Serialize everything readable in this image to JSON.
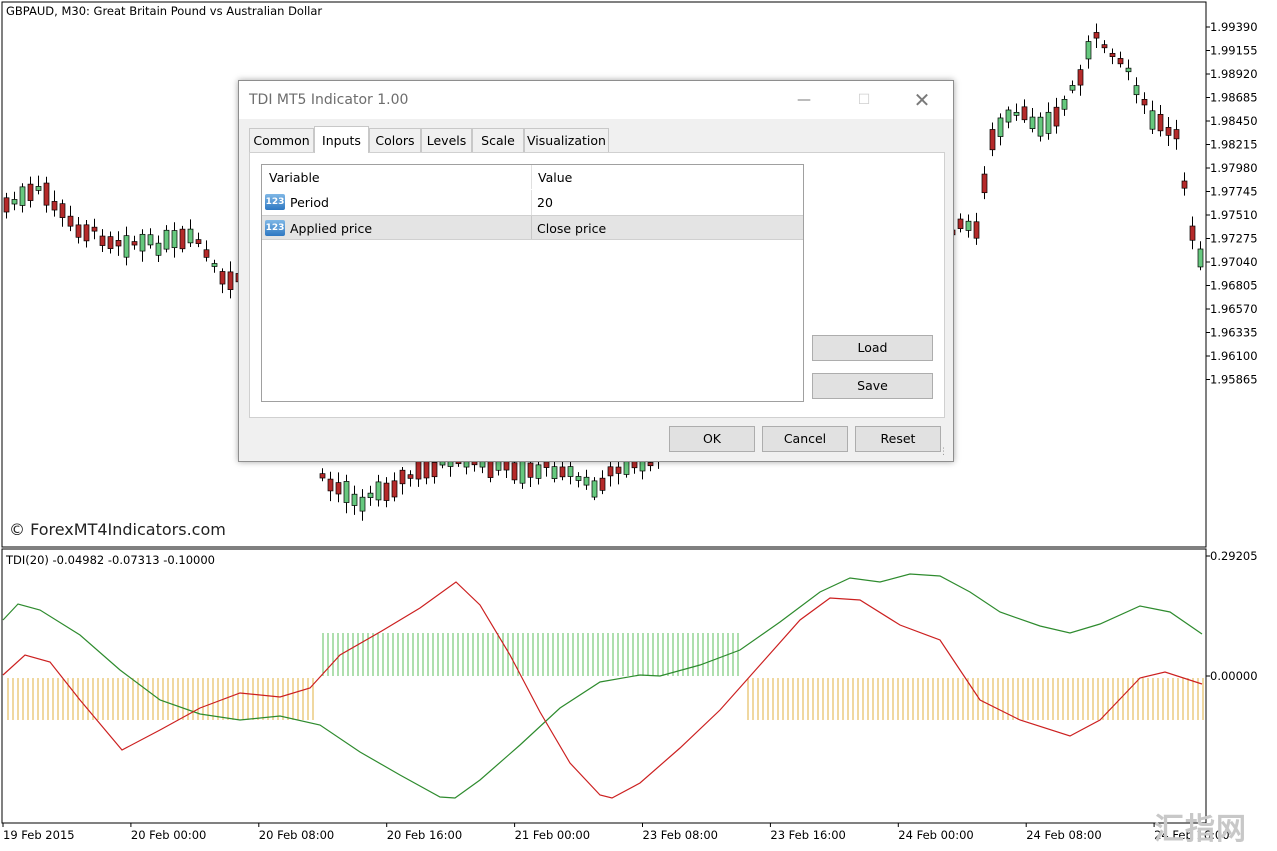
{
  "chart": {
    "symbol_title": "GBPAUD, M30:  Great Britain Pound vs Australian Dollar",
    "watermark": "© ForexMT4Indicators.com",
    "price_labels": [
      "1.99390",
      "1.99155",
      "1.98920",
      "1.98685",
      "1.98450",
      "1.98215",
      "1.97980",
      "1.97745",
      "1.97510",
      "1.97275",
      "1.97040",
      "1.96805",
      "1.96570",
      "1.96335",
      "1.96100",
      "1.95865"
    ],
    "indicator_label": "TDI(20) -0.04982 -0.07313 -0.10000",
    "indicator_scale": [
      "0.29205",
      "0.00000"
    ],
    "time_labels": [
      "19 Feb 2015",
      "20 Feb 00:00",
      "20 Feb 08:00",
      "20 Feb 16:00",
      "21 Feb 00:00",
      "23 Feb 08:00",
      "23 Feb 16:00",
      "24 Feb 00:00",
      "24 Feb 08:00",
      "24 Feb 16:00"
    ],
    "bull_color": "#66c87e",
    "bear_color": "#b52a2a",
    "tdi_green": "#2e8b2e",
    "tdi_red": "#cc2020",
    "hist_orange": "#e0b040",
    "hist_green": "#5cbf5c",
    "corner_brand": "汇指网"
  },
  "dialog": {
    "title": "TDI MT5 Indicator 1.00",
    "tabs": [
      {
        "label": "Common"
      },
      {
        "label": "Inputs"
      },
      {
        "label": "Colors"
      },
      {
        "label": "Levels"
      },
      {
        "label": "Scale"
      },
      {
        "label": "Visualization"
      }
    ],
    "grid": {
      "header_variable": "Variable",
      "header_value": "Value",
      "rows": [
        {
          "icon": "123",
          "variable": "Period",
          "value": "20"
        },
        {
          "icon": "123",
          "variable": "Applied price",
          "value": "Close price"
        }
      ]
    },
    "load_label": "Load",
    "save_label": "Save",
    "ok_label": "OK",
    "cancel_label": "Cancel",
    "reset_label": "Reset"
  }
}
